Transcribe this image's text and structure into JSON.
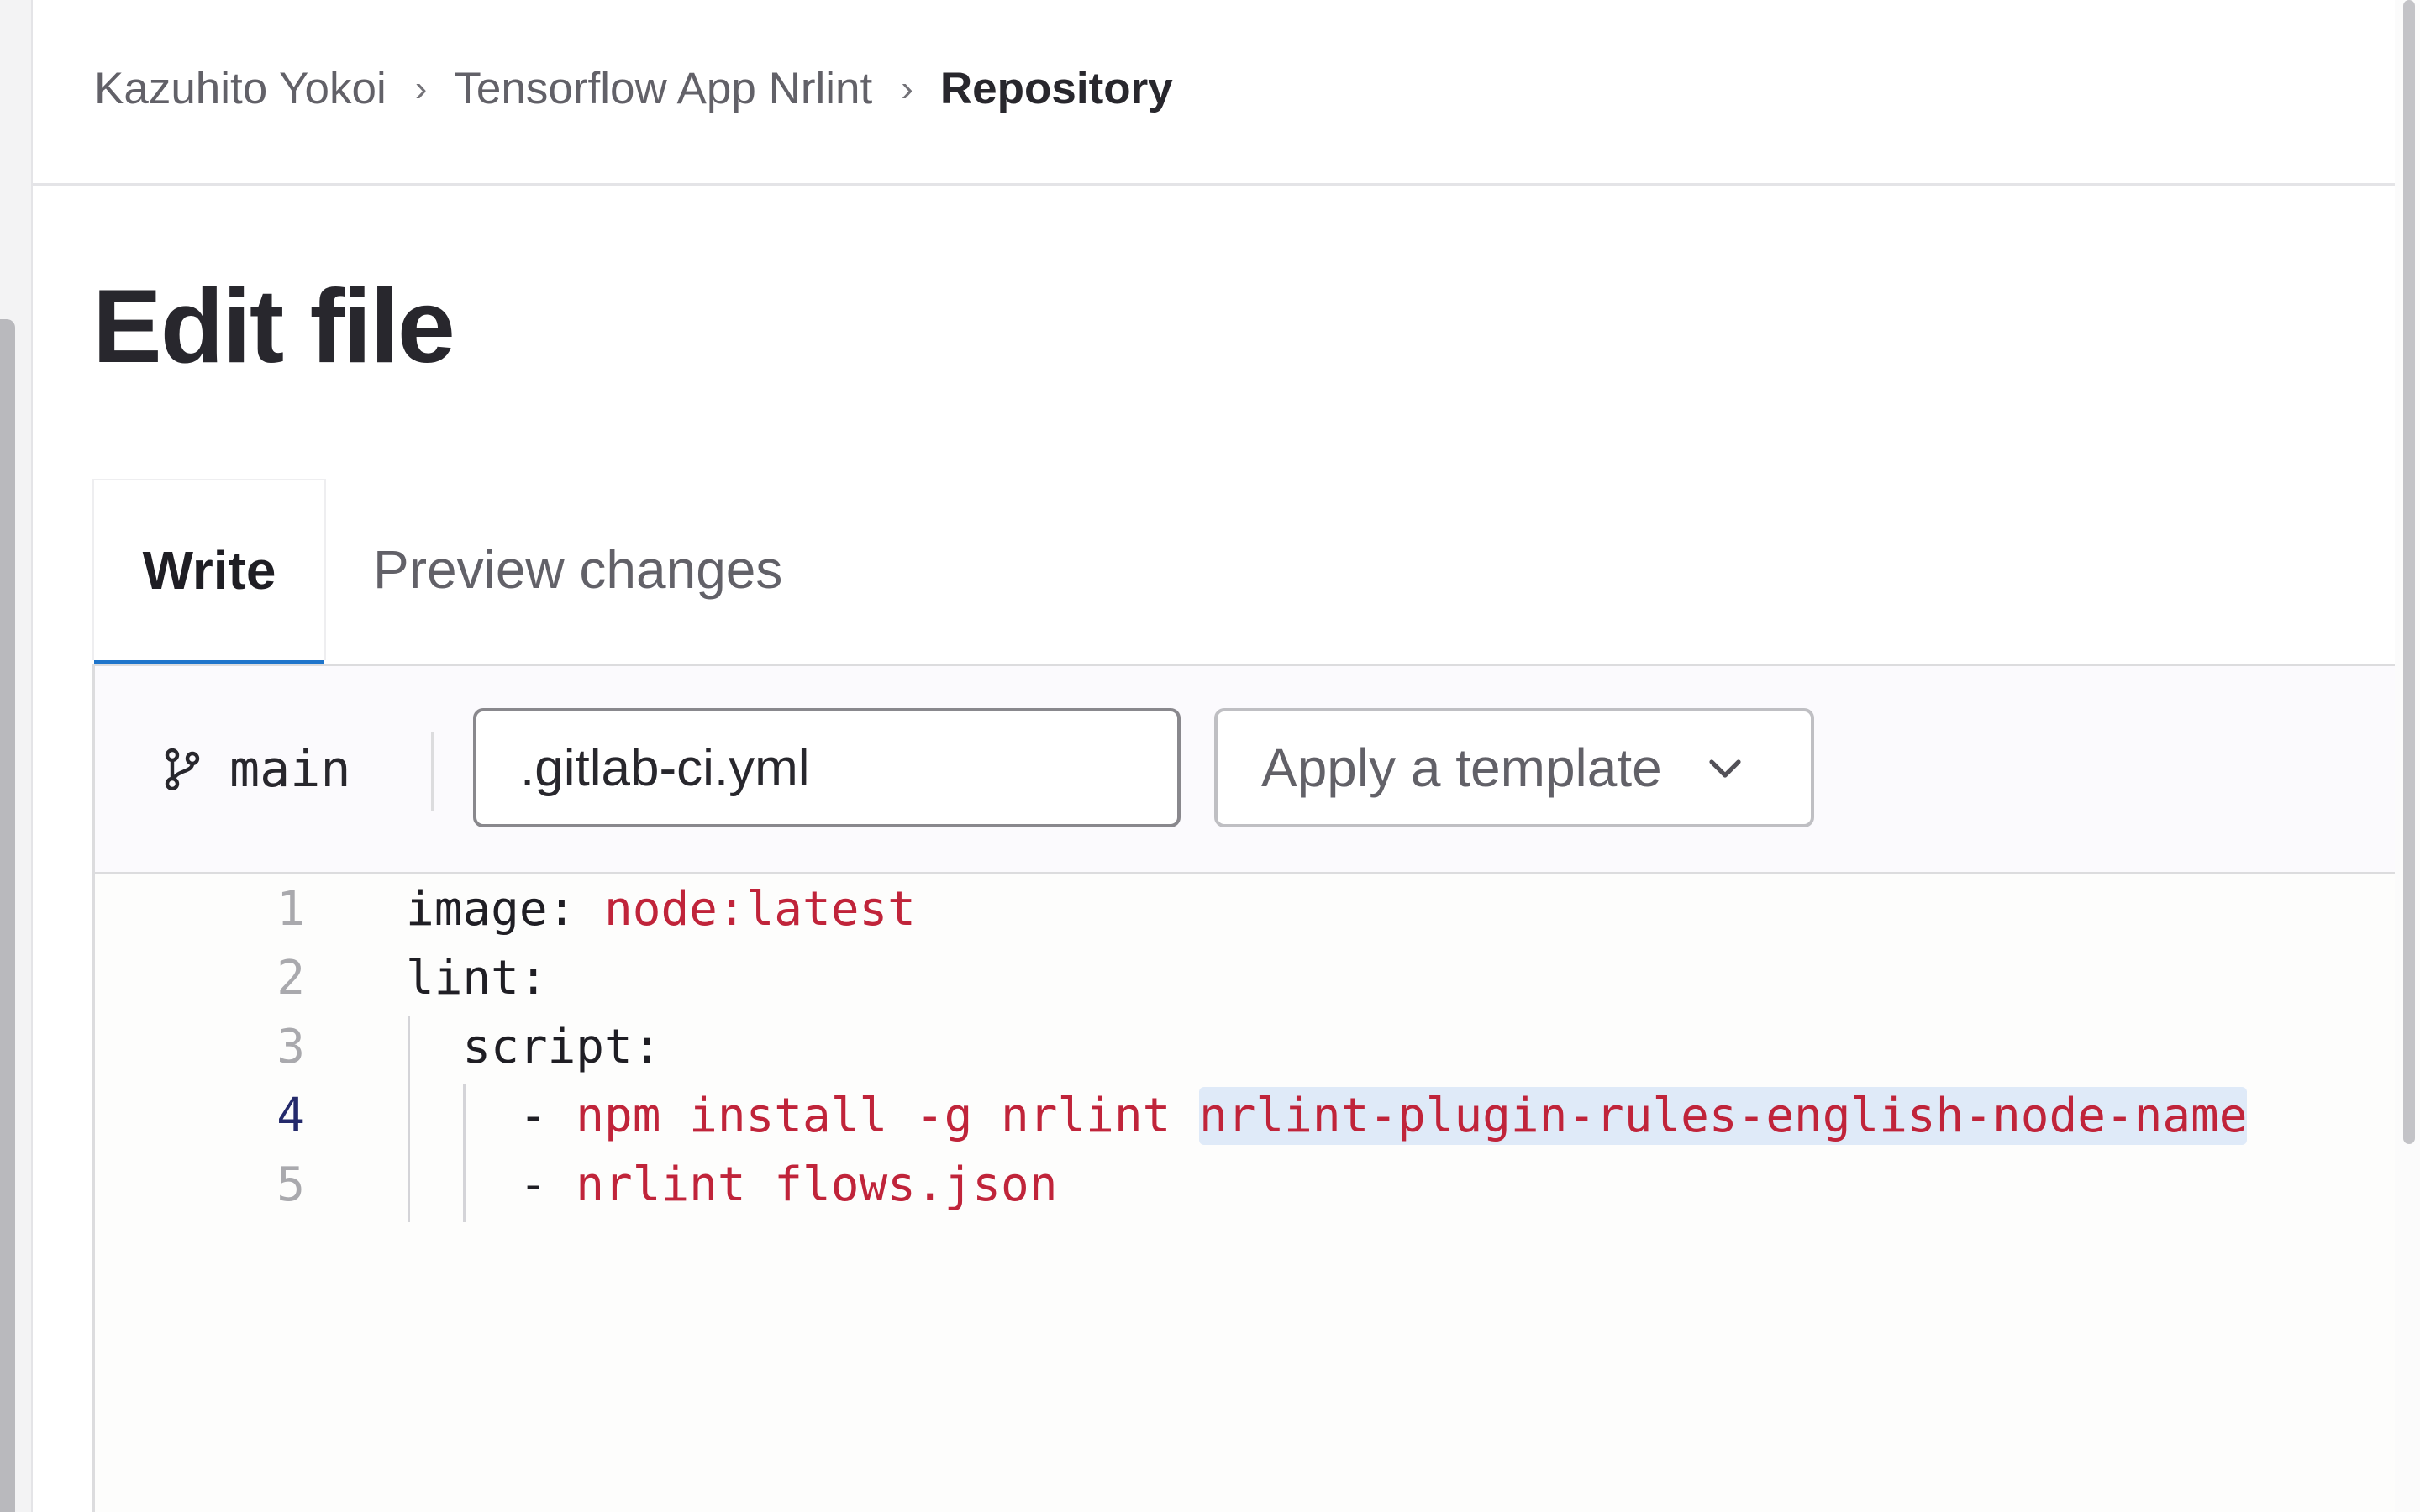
{
  "breadcrumb": {
    "items": [
      "Kazuhito Yokoi",
      "Tensorflow App Nrlint",
      "Repository"
    ],
    "separator": "›"
  },
  "page": {
    "title": "Edit file"
  },
  "tabs": [
    {
      "label": "Write",
      "active": true
    },
    {
      "label": "Preview changes",
      "active": false
    }
  ],
  "toolbar": {
    "branch_icon": "branch-icon",
    "branch": "main",
    "filename": ".gitlab-ci.yml",
    "template_label": "Apply a template",
    "template_icon": "chevron-down-icon"
  },
  "editor": {
    "active_line": 4,
    "lines": [
      {
        "num": "1",
        "key": "image:",
        "value": "node:latest"
      },
      {
        "num": "2",
        "key": "lint:",
        "value": ""
      },
      {
        "num": "3",
        "key": "  script:",
        "value": ""
      },
      {
        "num": "4",
        "key": "    - ",
        "value": "npm install -g nrlint ",
        "highlight": "nrlint-plugin-rules-english-node-name"
      },
      {
        "num": "5",
        "key": "    - ",
        "value": "nrlint flows.json"
      }
    ]
  },
  "colors": {
    "accent": "#1f75cb",
    "string": "#c0243a",
    "selection": "#dfeaf8"
  }
}
